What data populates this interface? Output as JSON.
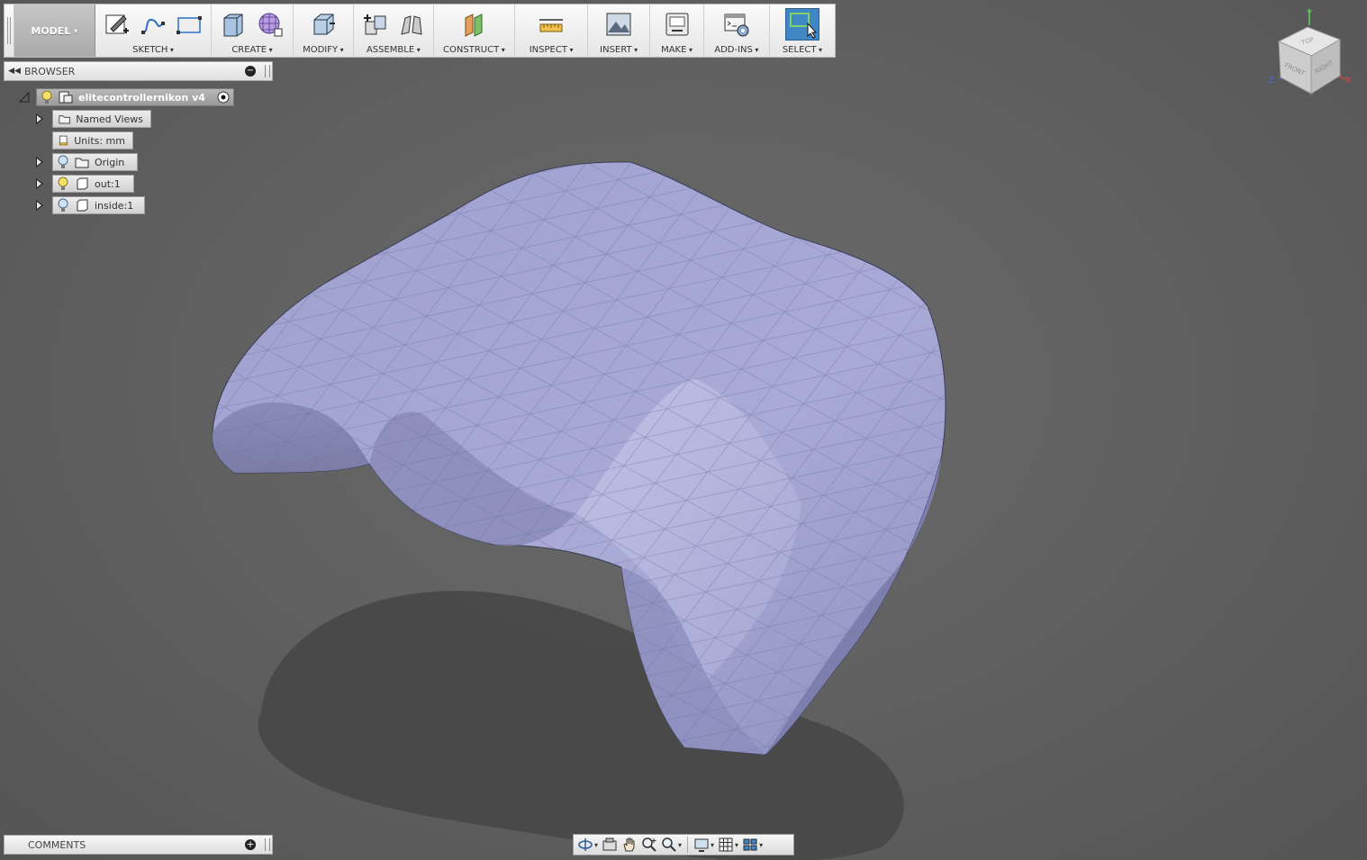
{
  "toolbar": {
    "workspace": "MODEL",
    "groups": [
      {
        "label": "SKETCH"
      },
      {
        "label": "CREATE"
      },
      {
        "label": "MODIFY"
      },
      {
        "label": "ASSEMBLE"
      },
      {
        "label": "CONSTRUCT"
      },
      {
        "label": "INSPECT"
      },
      {
        "label": "INSERT"
      },
      {
        "label": "MAKE"
      },
      {
        "label": "ADD-INS"
      },
      {
        "label": "SELECT"
      }
    ]
  },
  "browser": {
    "title": "BROWSER",
    "root": "elitecontrollernikon v4",
    "items": [
      {
        "label": "Named Views"
      },
      {
        "label": "Units: mm"
      },
      {
        "label": "Origin"
      },
      {
        "label": "out:1"
      },
      {
        "label": "inside:1"
      }
    ]
  },
  "comments": {
    "title": "COMMENTS"
  },
  "viewcube": {
    "top": "TOP",
    "front": "FRONT",
    "right": "RIGHT",
    "x": "X",
    "y": "Y",
    "z": "Z"
  },
  "colors": {
    "mesh": "#a7a8d2",
    "mesh_shade": "#8c8dbb",
    "background": "#5f5f5f",
    "select_accent": "#3f86c5"
  }
}
